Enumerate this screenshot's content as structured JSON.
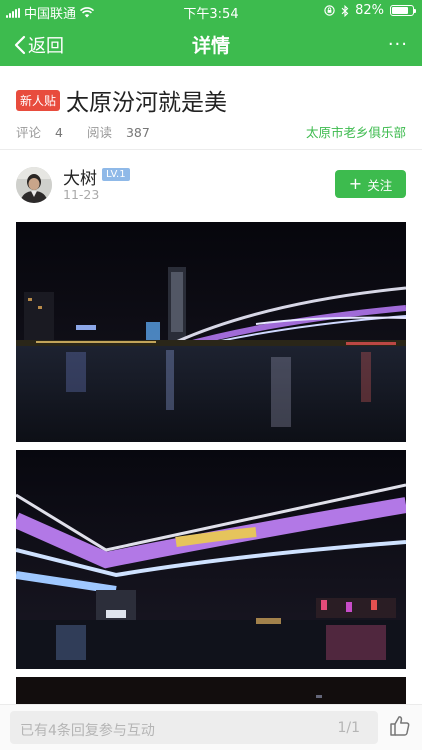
{
  "status_bar": {
    "carrier": "中国联通",
    "time": "下午3:54",
    "battery": "82%",
    "battery_level": 0.82
  },
  "nav": {
    "back_label": "返回",
    "title": "详情",
    "more_label": "···"
  },
  "post": {
    "badge": "新人贴",
    "title": "太原汾河就是美",
    "comment_label": "评论",
    "comment_count": "4",
    "read_label": "阅读",
    "read_count": "387",
    "club": "太原市老乡俱乐部"
  },
  "author": {
    "name": "大树",
    "level": "LV.1",
    "date": "11-23",
    "follow_label": "关注"
  },
  "bottom_bar": {
    "placeholder": "已有4条回复参与互动",
    "pager": "1/1"
  },
  "colors": {
    "brand_green": "#3dbb4e",
    "badge_red": "#e84c3d",
    "level_blue": "#8fb9e8"
  },
  "icons": {
    "back": "chevron-left-icon",
    "more": "more-dots-icon",
    "follow": "plus-icon",
    "like": "thumbs-up-icon"
  }
}
